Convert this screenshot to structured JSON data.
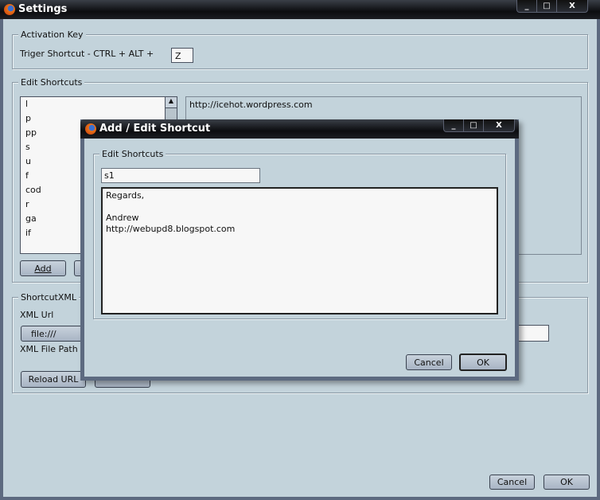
{
  "main": {
    "title": "Settings",
    "activation": {
      "legend": "Activation Key",
      "label": "Triger Shortcut - CTRL + ALT +",
      "key": "Z"
    },
    "edit": {
      "legend": "Edit Shortcuts",
      "items": [
        "l",
        "p",
        "pp",
        "s",
        "u",
        "f",
        "cod",
        "r",
        "ga",
        "if"
      ],
      "preview": "http://icehot.wordpress.com",
      "add": "Add"
    },
    "xml": {
      "legend": "ShortcutXML",
      "url_label": "XML Url",
      "url_button": "file:///",
      "path_label": "XML File Path",
      "reload": "Reload URL"
    },
    "cancel": "Cancel",
    "ok": "OK"
  },
  "dialog": {
    "title": "Add / Edit Shortcut",
    "legend": "Edit Shortcuts",
    "name": "s1",
    "text": "Regards,\n\nAndrew\nhttp://webupd8.blogspot.com",
    "cancel": "Cancel",
    "ok": "OK"
  },
  "window_buttons": {
    "min": "_",
    "max": "□",
    "close": "X"
  }
}
